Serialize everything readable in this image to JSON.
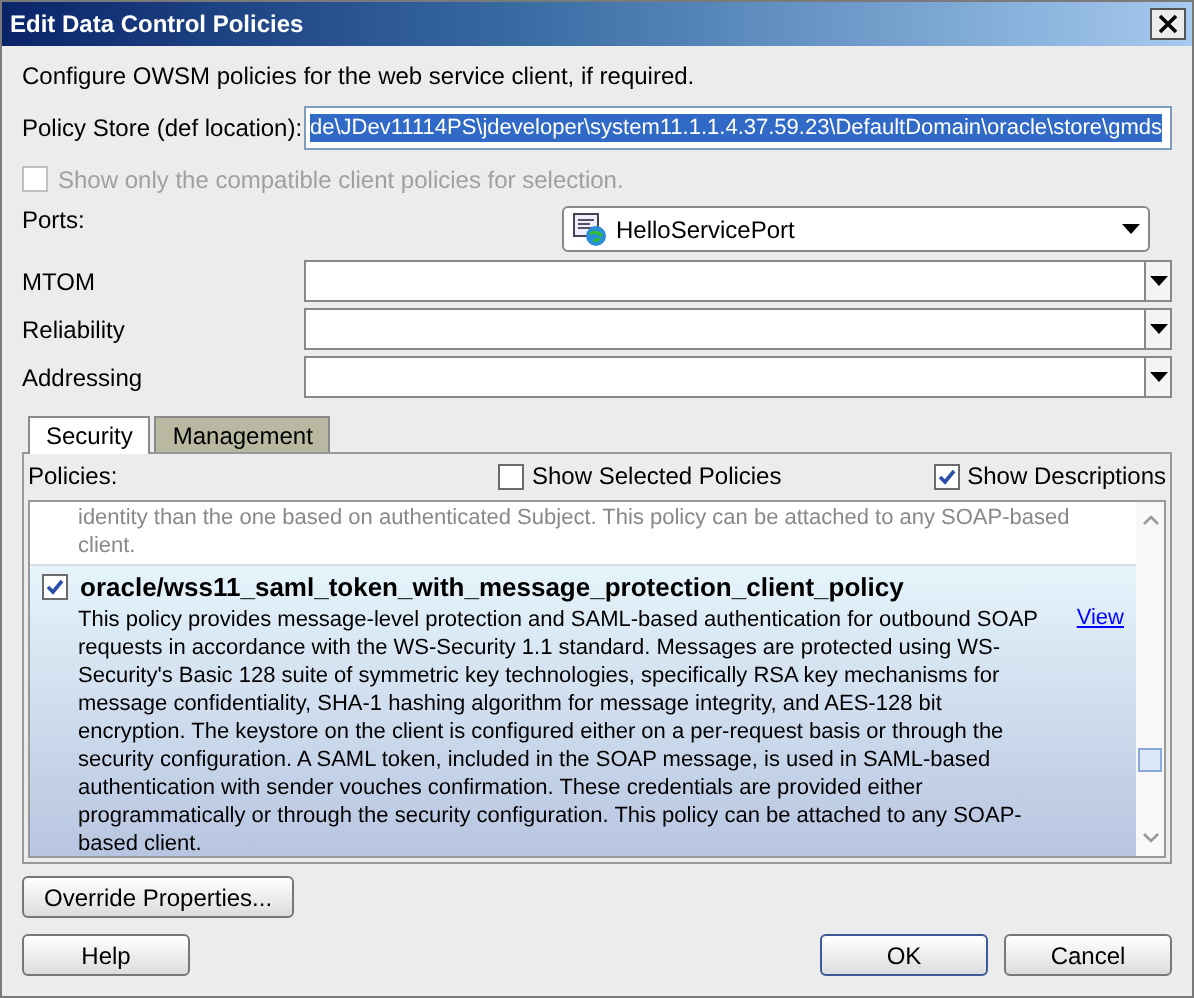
{
  "window": {
    "title": "Edit Data Control Policies"
  },
  "intro": "Configure OWSM policies for the web service client, if required.",
  "policy_store": {
    "label": "Policy Store (def location):",
    "value": "de\\JDev11114PS\\jdeveloper\\system11.1.1.4.37.59.23\\DefaultDomain\\oracle\\store\\gmds"
  },
  "compatible_only": {
    "label": "Show only the compatible client policies for selection.",
    "checked": false,
    "disabled": true
  },
  "ports": {
    "label": "Ports:",
    "value": "HelloServicePort"
  },
  "combos": [
    {
      "label": "MTOM"
    },
    {
      "label": "Reliability"
    },
    {
      "label": "Addressing"
    }
  ],
  "tabs": [
    {
      "label": "Security",
      "selected": true
    },
    {
      "label": "Management",
      "selected": false
    }
  ],
  "policies": {
    "label": "Policies:",
    "show_selected": {
      "label": "Show Selected Policies",
      "checked": false
    },
    "show_descriptions": {
      "label": "Show Descriptions",
      "checked": true
    },
    "items": [
      {
        "selected": false,
        "description": "identity than the one based on authenticated Subject. This policy can be attached to any SOAP-based client."
      },
      {
        "selected": true,
        "checked": true,
        "name": "oracle/wss11_saml_token_with_message_protection_client_policy",
        "description": "This policy provides message-level protection and SAML-based authentication for outbound SOAP requests in accordance with the WS-Security 1.1 standard. Messages are protected using WS-Security's Basic 128 suite of symmetric key technologies, specifically RSA key mechanisms for message confidentiality, SHA-1 hashing algorithm for message integrity, and AES-128 bit encryption. The keystore on the client is configured either on a per-request basis or through the security configuration. A SAML token, included in the SOAP message, is used in SAML-based authentication with sender vouches confirmation. These credentials are provided either programmatically or through the security configuration. This policy can be attached to any SOAP-based client.",
        "link": "View"
      }
    ]
  },
  "buttons": {
    "override": "Override Properties...",
    "help": "Help",
    "ok": "OK",
    "cancel": "Cancel"
  }
}
